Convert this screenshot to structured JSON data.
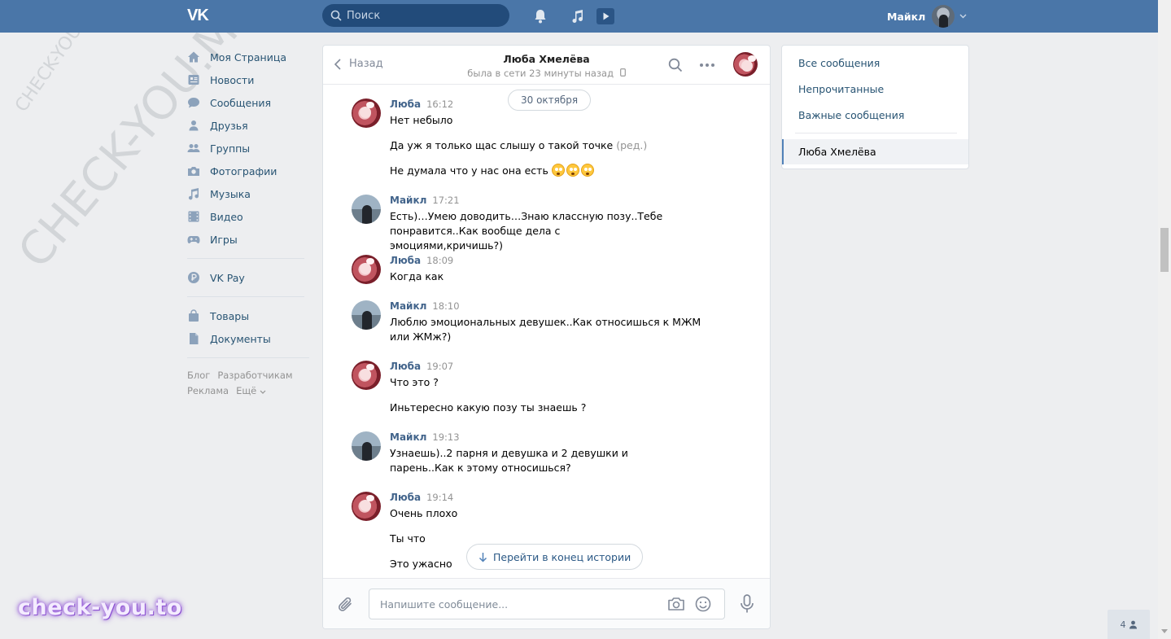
{
  "header": {
    "logo_text": "VK",
    "search_placeholder": "Поиск",
    "user_name": "Майкл"
  },
  "sidebar": {
    "items": [
      {
        "label": "Моя Страница",
        "icon": "home-icon"
      },
      {
        "label": "Новости",
        "icon": "news-icon"
      },
      {
        "label": "Сообщения",
        "icon": "messages-icon"
      },
      {
        "label": "Друзья",
        "icon": "friends-icon"
      },
      {
        "label": "Группы",
        "icon": "groups-icon"
      },
      {
        "label": "Фотографии",
        "icon": "camera-icon"
      },
      {
        "label": "Музыка",
        "icon": "music-icon"
      },
      {
        "label": "Видео",
        "icon": "video-icon"
      },
      {
        "label": "Игры",
        "icon": "gamepad-icon"
      }
    ],
    "vkpay": {
      "label": "VK Pay",
      "icon": "vkpay-icon"
    },
    "extra": [
      {
        "label": "Товары",
        "icon": "bag-icon"
      },
      {
        "label": "Документы",
        "icon": "document-icon"
      }
    ],
    "footer": {
      "blog": "Блог",
      "developers": "Разработчикам",
      "ads": "Реклама",
      "more": "Ещё"
    }
  },
  "chat": {
    "back_label": "Назад",
    "title": "Люба Хмелёва",
    "status": "была в сети 23 минуты назад",
    "date_divider": "30 октября",
    "goto_end_label": "Перейти в конец истории",
    "input_placeholder": "Напишите сообщение...",
    "messages": [
      {
        "author": "Люба",
        "time": "16:12",
        "avatar": "female",
        "texts": [
          "Нет небыло",
          "Да уж я только щас слышу о такой точке",
          "Не думала что у нас она есть"
        ],
        "edited_label": "(ред.)",
        "emoji_count": 3
      },
      {
        "author": "Майкл",
        "time": "17:21",
        "avatar": "male",
        "texts": [
          "Есть)…Умею доводить…Знаю классную позу..Тебе понравится..Как вообще дела с эмоциями,кричишь?)"
        ]
      },
      {
        "author": "Люба",
        "time": "18:09",
        "avatar": "female",
        "texts": [
          "Когда как"
        ]
      },
      {
        "author": "Майкл",
        "time": "18:10",
        "avatar": "male",
        "texts": [
          "Люблю эмоциональных девушек..Как относишься к МЖМ или ЖМж?)"
        ]
      },
      {
        "author": "Люба",
        "time": "19:07",
        "avatar": "female",
        "texts": [
          "Что это ?",
          "Иньтересно какую позу ты знаешь ?"
        ]
      },
      {
        "author": "Майкл",
        "time": "19:13",
        "avatar": "male",
        "texts": [
          "Узнаешь)..2 парня и девушка и 2 девушки и парень..Как к этому относишься?"
        ]
      },
      {
        "author": "Люба",
        "time": "19:14",
        "avatar": "female",
        "texts": [
          "Очень плохо",
          "Ты что",
          "Это ужасно"
        ]
      }
    ]
  },
  "filters": {
    "all": "Все сообщения",
    "unread": "Непрочитанные",
    "important": "Важные сообщения",
    "active_chat": "Люба Хмелёва"
  },
  "online_count": "4",
  "watermarks": {
    "large": "CHECK-YOU.ME",
    "small": "CHECK-YOU.ME",
    "brand": "check-you.to"
  },
  "colors": {
    "header": "#4a76a8",
    "link": "#285473",
    "author": "#42648b",
    "background": "#edeef0"
  }
}
